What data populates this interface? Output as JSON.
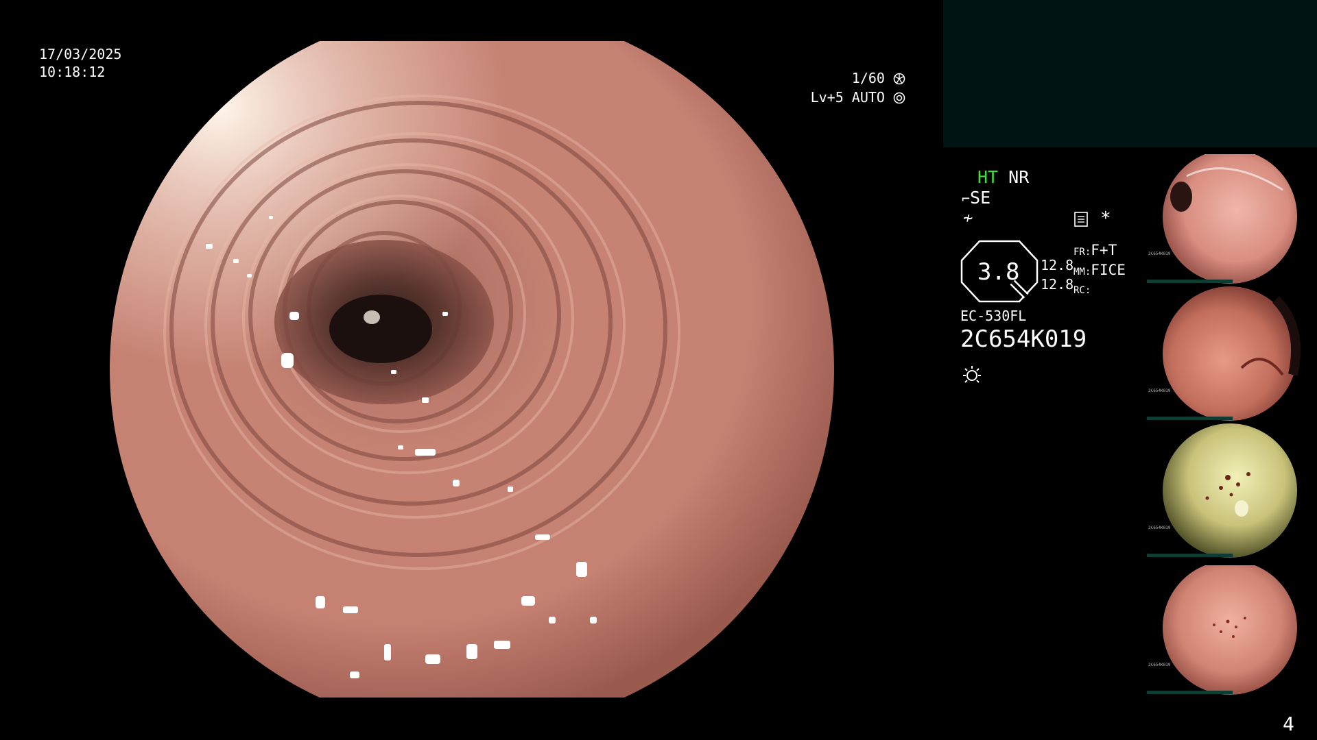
{
  "overlay": {
    "date": "17/03/2025",
    "time": "10:18:12",
    "shutter": "1/60",
    "level": "Lv+5 AUTO"
  },
  "info": {
    "ht": "HT",
    "nr": "NR",
    "se": "SE",
    "asterisk": "*",
    "octagon_value": "3.8",
    "num1": "12.8",
    "num2": "12.8",
    "fr_label": "FR:",
    "fr_value": "F+T",
    "mm_label": "MM:",
    "mm_value": "FICE",
    "rc_label": "RC:",
    "scope_model": "EC-530FL",
    "serial": "2C654K019",
    "ht_color": "#3ee23e",
    "panel_color": "#011414"
  },
  "thumbnails": [
    {
      "label": "2C654K019",
      "tone": "pink"
    },
    {
      "label": "2C654K019",
      "tone": "red"
    },
    {
      "label": "2C654K019",
      "tone": "yellow"
    },
    {
      "label": "2C654K019",
      "tone": "pink-spotted"
    }
  ],
  "page_number": "4"
}
